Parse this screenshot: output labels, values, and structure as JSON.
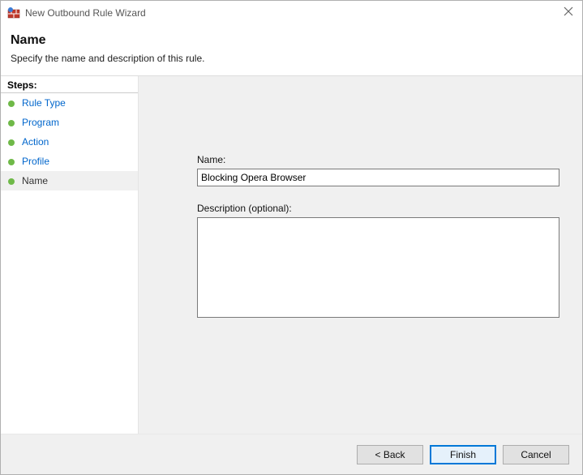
{
  "window": {
    "title": "New Outbound Rule Wizard"
  },
  "header": {
    "title": "Name",
    "subtitle": "Specify the name and description of this rule."
  },
  "sidebar": {
    "title": "Steps:",
    "items": [
      {
        "label": "Rule Type",
        "state": "done"
      },
      {
        "label": "Program",
        "state": "done"
      },
      {
        "label": "Action",
        "state": "done"
      },
      {
        "label": "Profile",
        "state": "done"
      },
      {
        "label": "Name",
        "state": "current"
      }
    ]
  },
  "form": {
    "name_label": "Name:",
    "name_value": "Blocking Opera Browser",
    "description_label": "Description (optional):",
    "description_value": ""
  },
  "buttons": {
    "back": "< Back",
    "finish": "Finish",
    "cancel": "Cancel"
  }
}
